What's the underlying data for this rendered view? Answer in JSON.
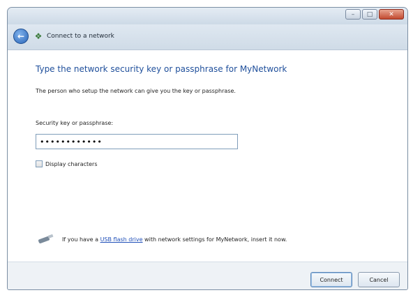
{
  "window": {
    "caption_buttons": {
      "minimize_icon": "minimize-icon",
      "maximize_icon": "maximize-icon",
      "close_icon": "close-icon"
    }
  },
  "nav": {
    "back_icon": "back-arrow-icon",
    "network_icon": "network-icon",
    "title": "Connect to a network"
  },
  "content": {
    "heading": "Type the network security key or passphrase for MyNetwork",
    "subtext": "The person who setup the network can give you the key or passphrase.",
    "key_label": "Security key or passphrase:",
    "key_value": "••••••••••••",
    "display_characters_label": "Display characters",
    "display_characters_checked": false,
    "usb": {
      "icon": "usb-flash-drive-icon",
      "prefix": "If you have a ",
      "link": "USB flash drive",
      "suffix": " with network settings for MyNetwork, insert it now."
    }
  },
  "footer": {
    "connect_label": "Connect",
    "cancel_label": "Cancel"
  },
  "colors": {
    "heading": "#1f4f9b",
    "link": "#1f4fb8",
    "window_frame": "#c9d6e3"
  }
}
